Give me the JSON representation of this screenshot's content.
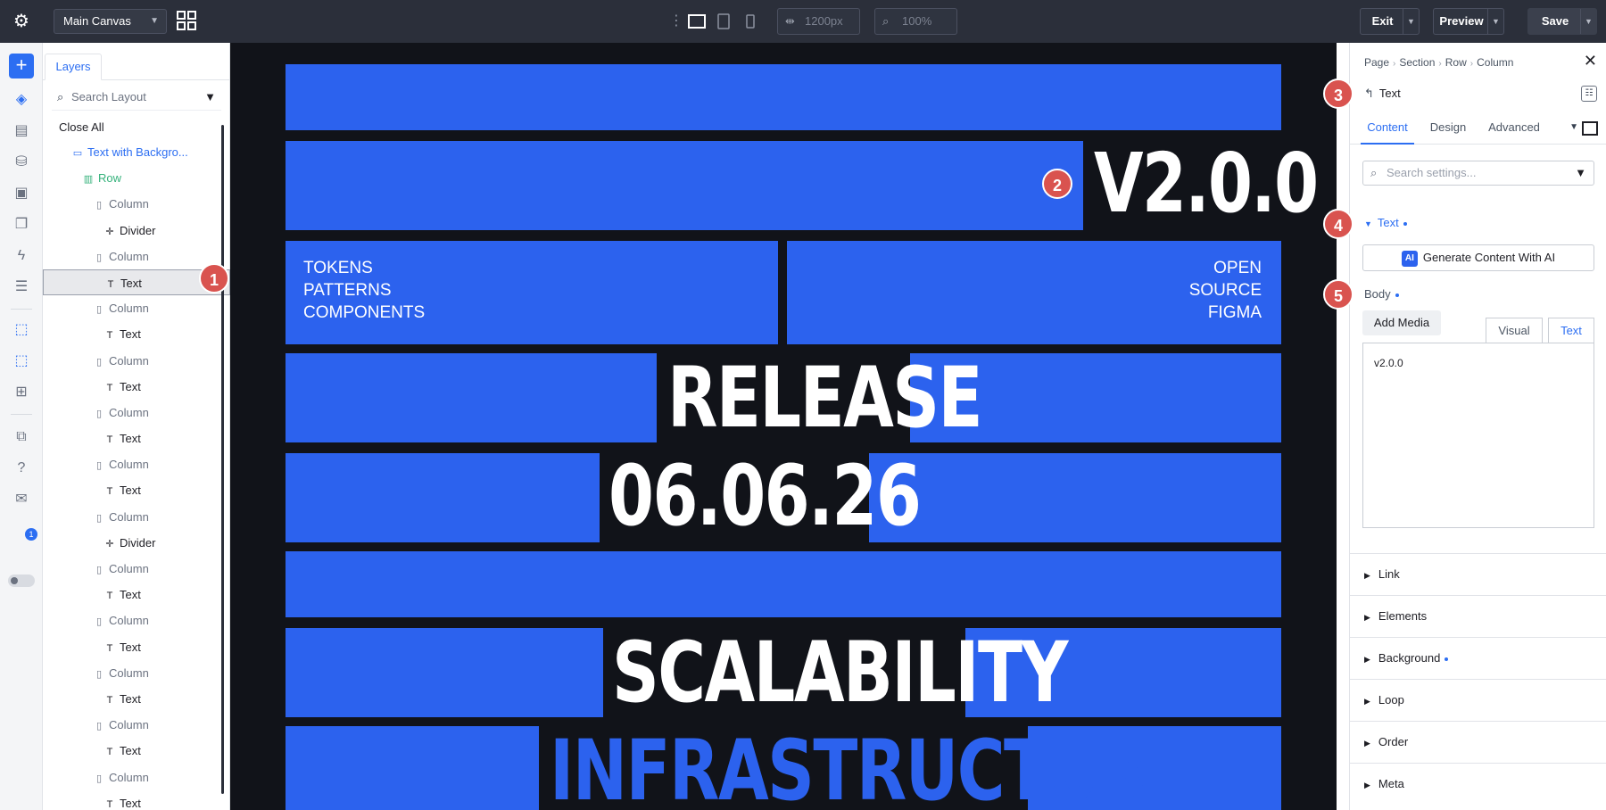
{
  "topbar": {
    "canvas_select": "Main Canvas",
    "width_field": "1200px",
    "zoom_field": "100%",
    "exit_label": "Exit",
    "preview_label": "Preview",
    "save_label": "Save"
  },
  "rail": {
    "notification_count": "1"
  },
  "layers": {
    "tab_label": "Layers",
    "search_placeholder": "Search Layout",
    "close_all": "Close All",
    "items": [
      {
        "label": "Text with Backgro...",
        "icon": "section-icon",
        "level": 0
      },
      {
        "label": "Row",
        "icon": "row-icon",
        "level": 1
      },
      {
        "label": "Column",
        "icon": "column-icon",
        "level": 2
      },
      {
        "label": "Divider",
        "icon": "divider-icon",
        "level": 3
      },
      {
        "label": "Column",
        "icon": "column-icon",
        "level": 2
      },
      {
        "label": "Text",
        "icon": "text-icon",
        "level": 3,
        "selected": true
      },
      {
        "label": "Column",
        "icon": "column-icon",
        "level": 2
      },
      {
        "label": "Text",
        "icon": "text-icon",
        "level": 3
      },
      {
        "label": "Column",
        "icon": "column-icon",
        "level": 2
      },
      {
        "label": "Text",
        "icon": "text-icon",
        "level": 3
      },
      {
        "label": "Column",
        "icon": "column-icon",
        "level": 2
      },
      {
        "label": "Text",
        "icon": "text-icon",
        "level": 3
      },
      {
        "label": "Column",
        "icon": "column-icon",
        "level": 2
      },
      {
        "label": "Text",
        "icon": "text-icon",
        "level": 3
      },
      {
        "label": "Column",
        "icon": "column-icon",
        "level": 2
      },
      {
        "label": "Divider",
        "icon": "divider-icon",
        "level": 3
      },
      {
        "label": "Column",
        "icon": "column-icon",
        "level": 2
      },
      {
        "label": "Text",
        "icon": "text-icon",
        "level": 3
      },
      {
        "label": "Column",
        "icon": "column-icon",
        "level": 2
      },
      {
        "label": "Text",
        "icon": "text-icon",
        "level": 3
      },
      {
        "label": "Column",
        "icon": "column-icon",
        "level": 2
      },
      {
        "label": "Text",
        "icon": "text-icon",
        "level": 3
      },
      {
        "label": "Column",
        "icon": "column-icon",
        "level": 2
      },
      {
        "label": "Text",
        "icon": "text-icon",
        "level": 3
      },
      {
        "label": "Column",
        "icon": "column-icon",
        "level": 2
      },
      {
        "label": "Text",
        "icon": "text-icon",
        "level": 3
      }
    ]
  },
  "canvas": {
    "version": "V2.0.0",
    "left_lines": [
      "TOKENS",
      "PATTERNS",
      "COMPONENTS"
    ],
    "right_lines": [
      "OPEN",
      "SOURCE",
      "FIGMA"
    ],
    "release": "RELEASE",
    "date": "06.06.26",
    "scalability": "SCALABILITY",
    "infrastructure": "INFRASTRUCTURE",
    "accent_color": "#2c62ee",
    "background_color": "#111319"
  },
  "markers": [
    "1",
    "2",
    "3",
    "4",
    "5"
  ],
  "settings": {
    "breadcrumb": [
      "Page",
      "Section",
      "Row",
      "Column"
    ],
    "module_title": "Text",
    "tabs": [
      "Content",
      "Design",
      "Advanced"
    ],
    "search_placeholder": "Search settings...",
    "text_section": "Text",
    "ai_button": "Generate Content With AI",
    "ai_badge": "AI",
    "body_label": "Body",
    "add_media": "Add Media",
    "visual_tab": "Visual",
    "text_tab": "Text",
    "body_value": "v2.0.0",
    "accordions": [
      "Link",
      "Elements",
      "Background",
      "Loop",
      "Order",
      "Meta"
    ]
  }
}
